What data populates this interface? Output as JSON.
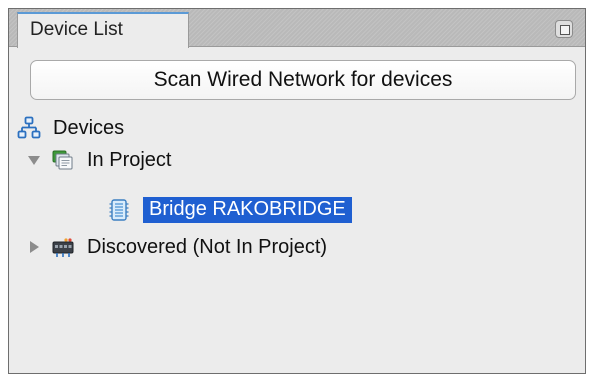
{
  "panel": {
    "tab_label": "Device List",
    "tab_menu_icon": "panel-menu-icon"
  },
  "toolbar": {
    "scan_label": "Scan Wired Network for devices"
  },
  "tree": {
    "root": {
      "label": "Devices",
      "icon": "network-tree-icon"
    },
    "in_project": {
      "label": "In Project",
      "icon": "project-devices-icon",
      "expanded": true,
      "children": [
        {
          "label": "Bridge RAKOBRIDGE",
          "icon": "bridge-chip-icon",
          "selected": true
        }
      ]
    },
    "discovered": {
      "label": "Discovered (Not In Project)",
      "icon": "network-switch-icon",
      "expanded": false
    }
  },
  "colors": {
    "selection": "#1f5fd1",
    "tab_accent": "#5b9ad6"
  }
}
